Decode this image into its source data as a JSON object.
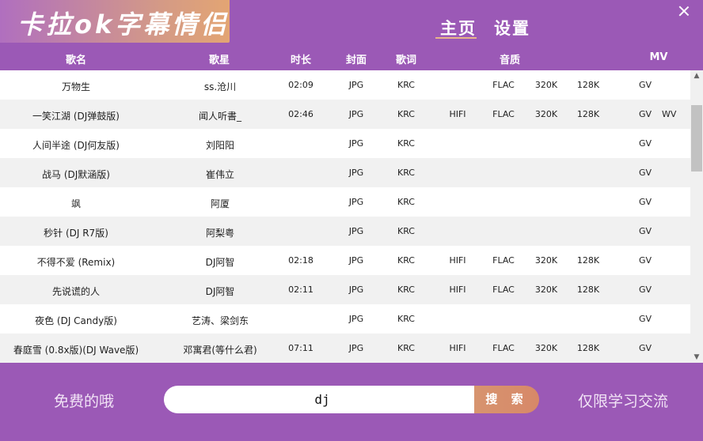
{
  "app": {
    "title": "卡拉ok字幕情侣",
    "nav": {
      "home": "主页",
      "settings": "设置"
    }
  },
  "columns": {
    "title": "歌名",
    "artist": "歌星",
    "duration": "时长",
    "cover": "封面",
    "lyrics": "歌词",
    "quality": "音质",
    "mv": "MV"
  },
  "rows": [
    {
      "title": "万物生",
      "artist": "ss.沧川",
      "duration": "02:09",
      "cover": "JPG",
      "lyrics": "KRC",
      "hifi": "",
      "flac": "FLAC",
      "q320": "320K",
      "q128": "128K",
      "gv": "GV",
      "wv": ""
    },
    {
      "title": "一笑江湖 (DJ弹鼓版)",
      "artist": "闻人听書_",
      "duration": "02:46",
      "cover": "JPG",
      "lyrics": "KRC",
      "hifi": "HIFI",
      "flac": "FLAC",
      "q320": "320K",
      "q128": "128K",
      "gv": "GV",
      "wv": "WV"
    },
    {
      "title": "人间半途 (DJ何友版)",
      "artist": "刘阳阳",
      "duration": "",
      "cover": "JPG",
      "lyrics": "KRC",
      "hifi": "",
      "flac": "",
      "q320": "",
      "q128": "",
      "gv": "GV",
      "wv": ""
    },
    {
      "title": "战马 (DJ默涵版)",
      "artist": "崔伟立",
      "duration": "",
      "cover": "JPG",
      "lyrics": "KRC",
      "hifi": "",
      "flac": "",
      "q320": "",
      "q128": "",
      "gv": "GV",
      "wv": ""
    },
    {
      "title": "飒",
      "artist": "阿厦",
      "duration": "",
      "cover": "JPG",
      "lyrics": "KRC",
      "hifi": "",
      "flac": "",
      "q320": "",
      "q128": "",
      "gv": "GV",
      "wv": ""
    },
    {
      "title": "秒针 (DJ R7版)",
      "artist": "阿梨粤",
      "duration": "",
      "cover": "JPG",
      "lyrics": "KRC",
      "hifi": "",
      "flac": "",
      "q320": "",
      "q128": "",
      "gv": "GV",
      "wv": ""
    },
    {
      "title": "不得不爱 (Remix)",
      "artist": "DJ阿智",
      "duration": "02:18",
      "cover": "JPG",
      "lyrics": "KRC",
      "hifi": "HIFI",
      "flac": "FLAC",
      "q320": "320K",
      "q128": "128K",
      "gv": "GV",
      "wv": ""
    },
    {
      "title": "先说谎的人",
      "artist": "DJ阿智",
      "duration": "02:11",
      "cover": "JPG",
      "lyrics": "KRC",
      "hifi": "HIFI",
      "flac": "FLAC",
      "q320": "320K",
      "q128": "128K",
      "gv": "GV",
      "wv": ""
    },
    {
      "title": "夜色 (DJ Candy版)",
      "artist": "艺涛、梁剑东",
      "duration": "",
      "cover": "JPG",
      "lyrics": "KRC",
      "hifi": "",
      "flac": "",
      "q320": "",
      "q128": "",
      "gv": "GV",
      "wv": ""
    },
    {
      "title": "春庭雪 (0.8x版)(DJ Wave版)",
      "artist": "邓寓君(等什么君)",
      "duration": "07:11",
      "cover": "JPG",
      "lyrics": "KRC",
      "hifi": "HIFI",
      "flac": "FLAC",
      "q320": "320K",
      "q128": "128K",
      "gv": "GV",
      "wv": ""
    }
  ],
  "footer": {
    "left_text": "免费的哦",
    "right_text": "仅限学习交流",
    "search_value": "dj",
    "search_button": "搜 索"
  },
  "icons": {
    "close": "close-icon",
    "scroll_up": "chevron-up-icon",
    "scroll_down": "chevron-down-icon"
  },
  "colors": {
    "primary": "#9b59b6",
    "accent": "#d7946f"
  }
}
